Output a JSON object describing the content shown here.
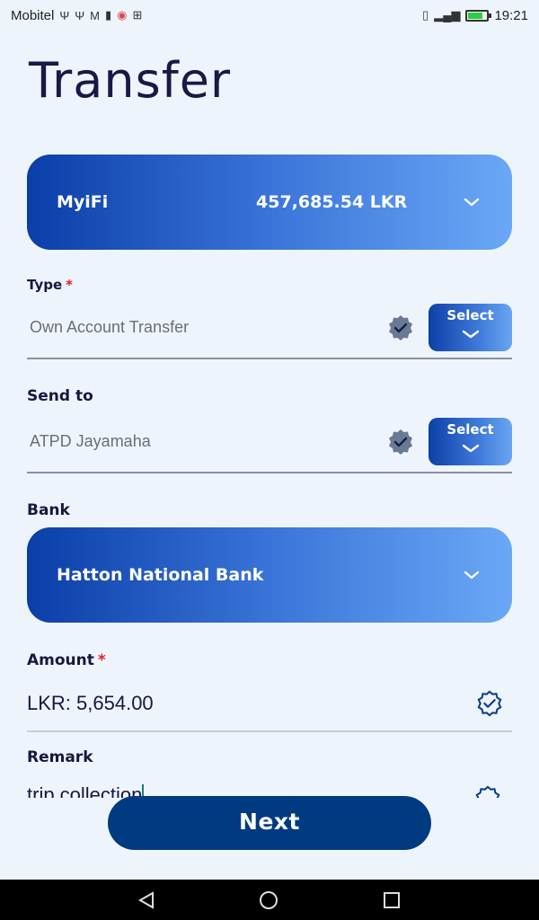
{
  "status_bar": {
    "carrier": "Mobitel",
    "time": "19:21"
  },
  "page": {
    "title": "Transfer"
  },
  "account_card": {
    "name": "MyiFi",
    "balance": "457,685.54 LKR"
  },
  "type_field": {
    "label": "Type",
    "required_mark": "*",
    "value": "Own Account Transfer",
    "select_label": "Select"
  },
  "send_to_field": {
    "label": "Send to",
    "value": "ATPD Jayamaha",
    "select_label": "Select"
  },
  "bank_field": {
    "label": "Bank",
    "value": "Hatton National Bank"
  },
  "amount_field": {
    "label": "Amount",
    "required_mark": "*",
    "value": "LKR: 5,654.00"
  },
  "remark_field": {
    "label": "Remark",
    "value": "trip collection"
  },
  "actions": {
    "next_label": "Next"
  },
  "colors": {
    "accent_dark": "#003a80",
    "gradient_start": "#0a3ea8",
    "gradient_end": "#6aa8f6",
    "required": "#e0221f"
  }
}
